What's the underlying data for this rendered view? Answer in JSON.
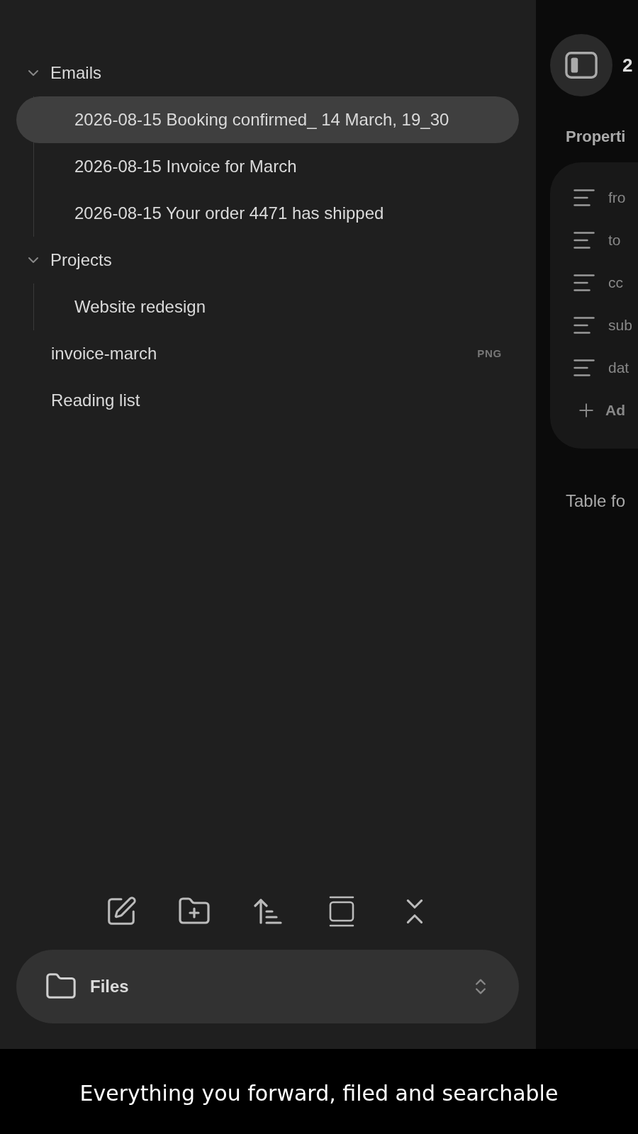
{
  "sidebar": {
    "tree": [
      {
        "kind": "folder",
        "label": "Emails",
        "expanded": true,
        "selected": false,
        "children": [
          {
            "label": "2026-08-15 Booking confirmed_ 14 March, 19_30",
            "selected": true
          },
          {
            "label": "2026-08-15 Invoice for March",
            "selected": false
          },
          {
            "label": "2026-08-15 Your order 4471 has shipped",
            "selected": false
          }
        ]
      },
      {
        "kind": "folder",
        "label": "Projects",
        "expanded": true,
        "selected": false,
        "children": [
          {
            "label": "Website redesign",
            "selected": false
          }
        ]
      },
      {
        "kind": "file",
        "label": "invoice-march",
        "badge": "PNG",
        "selected": false
      },
      {
        "kind": "file",
        "label": "Reading list",
        "selected": false
      }
    ],
    "view_switcher": {
      "label": "Files"
    }
  },
  "note": {
    "title": "2",
    "properties_heading": "Properti",
    "properties": [
      "fro",
      "to",
      "cc",
      "sub",
      "dat"
    ],
    "add_label": "Ad",
    "section_heading": "Table fo"
  },
  "caption": "Everything you forward, filed and searchable"
}
